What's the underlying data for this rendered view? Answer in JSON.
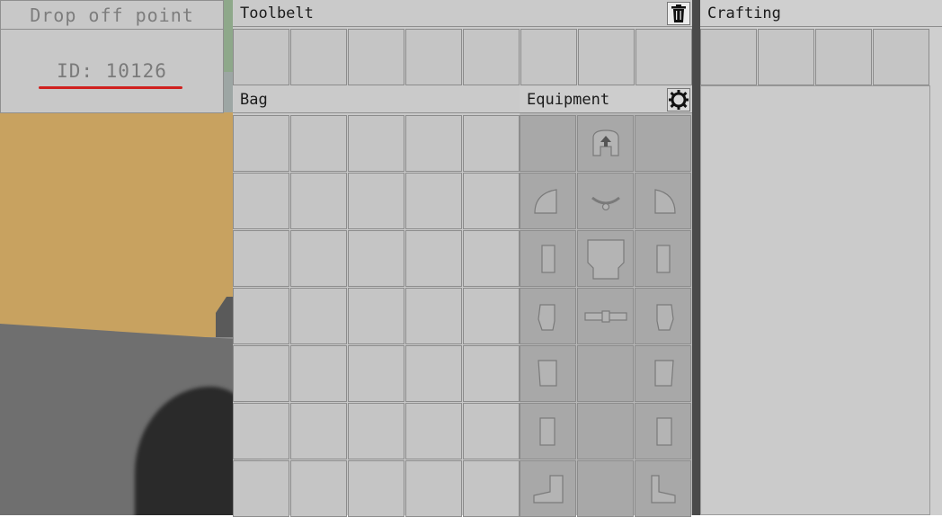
{
  "drop_off": {
    "title": "Drop off point",
    "id_text": "ID: 10126"
  },
  "toolbelt": {
    "title": "Toolbelt",
    "slot_count": 8,
    "trash_icon": "trash-icon"
  },
  "bag": {
    "title": "Bag",
    "columns": 5,
    "rows": 7
  },
  "equipment": {
    "title": "Equipment",
    "settings_icon": "gear-icon",
    "slots": [
      [
        "",
        "helmet-icon",
        ""
      ],
      [
        "shoulder-left-icon",
        "necklace-icon",
        "shoulder-right-icon"
      ],
      [
        "bracer-left-icon",
        "chest-armor-icon",
        "bracer-right-icon"
      ],
      [
        "glove-left-icon",
        "belt-icon",
        "glove-right-icon"
      ],
      [
        "leg-left-icon",
        "",
        "leg-right-icon"
      ],
      [
        "shin-left-icon",
        "",
        "shin-right-icon"
      ],
      [
        "boot-left-icon",
        "",
        "boot-right-icon"
      ]
    ]
  },
  "crafting": {
    "title": "Crafting",
    "slot_count": 4
  },
  "colors": {
    "underline": "#d0201e",
    "panel": "#cdcdcd",
    "equip_slot": "#a8a8a8"
  }
}
